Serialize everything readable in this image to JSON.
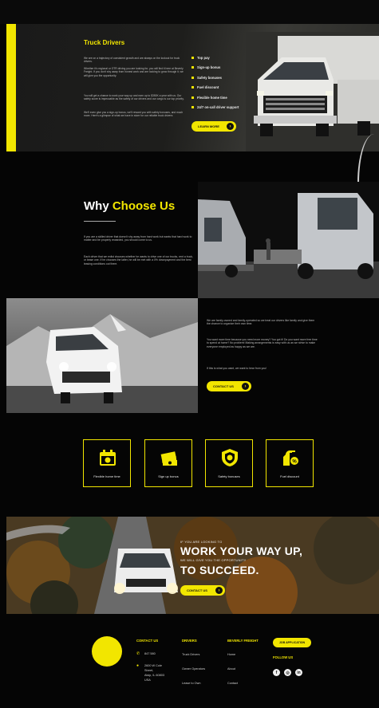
{
  "hero": {
    "title": "Truck Drivers",
    "paragraphs": [
      "We are on a trajectory of consistent growth and are always on the lookout for truck drivers.",
      "Whether it's regional or OTR driving you are looking for, you will find it here at Beverly Freight. If you don't shy away from honest work and are looking to grow through it, we will give you the opportunity.",
      "You will get a chance to work your way up and earn up to $350K a year with us. Our safety score is impeccable as the safety of our drivers and our cargo is our top priority.",
      "We'll even give you a sign-up bonus, we'll reward you with safety bonuses, and much more. Here's a glimpse of what we have in store for our reliable truck drivers:"
    ],
    "benefits": [
      "Top pay",
      "Sign-up bonus",
      "Safety bonuses",
      "Fuel discount",
      "Flexible home time",
      "24/7 on-call driver support"
    ],
    "button": "LEARN MORE"
  },
  "why": {
    "title_plain": "Why ",
    "title_accent": "Choose Us",
    "paragraphs": [
      "If you are a skilled driver that doesn't shy away from hard work but wants that hard work to matter and be properly rewarded, you should come to us.",
      "Each driver that we enlist chooses whether he wants to drive one of our trucks, rent a truck, or lease one. If he chooses the latter, he will be met with a 0% downpayment and the best leasing conditions out there."
    ]
  },
  "family": {
    "paragraphs": [
      "We are family-owned and family-operated so we treat our drivers like family and give them the chance to organize their own time.",
      "You want more time because you need more money? You got it! Do you want more free time to spend at home? No problem! Making arrangements is easy with us as we strive to make everyone employed as happy as we are.",
      "If this is what you want, we want to hear from you!"
    ],
    "button": "CONTACT US"
  },
  "features": [
    {
      "label": "Flexible home time",
      "icon": "calendar-icon"
    },
    {
      "label": "Sign up bonus",
      "icon": "cash-icon"
    },
    {
      "label": "Safety bonuses",
      "icon": "shield-icon"
    },
    {
      "label": "Fuel discount",
      "icon": "fuel-icon"
    }
  ],
  "banner": {
    "line1": "IF YOU ARE LOOKING TO",
    "big1": "WORK YOUR WAY UP,",
    "line2": "WE WILL GIVE YOU THE OPPORTUNITY",
    "big2": "TO SUCCEED.",
    "button": "CONTACT US"
  },
  "footer": {
    "contact_heading": "CONTACT US",
    "phone": "847 580",
    "address": [
      "2600 W Cole",
      "Street,",
      "Alsip, IL 60803",
      "USA"
    ],
    "drivers_heading": "DRIVERS",
    "drivers_links": [
      "Truck Drivers",
      "Owner Operators",
      "Lease to Own"
    ],
    "company_heading": "BEVERLY FREIGHT",
    "company_links": [
      "Home",
      "About",
      "Contact"
    ],
    "job_button": "JOB APPLICATION",
    "follow_heading": "FOLLOW US",
    "social": [
      "facebook-icon",
      "instagram-icon",
      "linkedin-icon"
    ]
  },
  "colors": {
    "accent": "#f2e600",
    "background": "#050505"
  }
}
